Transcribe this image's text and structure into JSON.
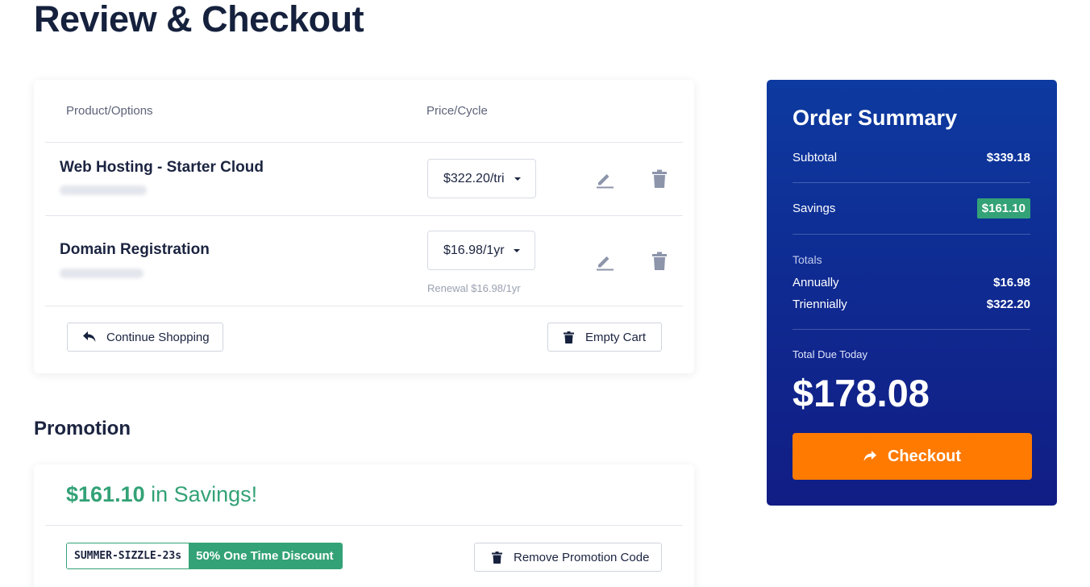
{
  "page": {
    "title": "Review & Checkout"
  },
  "cart": {
    "columns": {
      "product": "Product/Options",
      "price": "Price/Cycle"
    },
    "items": [
      {
        "name": "Web Hosting - Starter Cloud",
        "price_cycle": "$322.20/tri",
        "renewal": ""
      },
      {
        "name": "Domain Registration",
        "price_cycle": "$16.98/1yr",
        "renewal": "Renewal $16.98/1yr"
      }
    ],
    "continue_label": "Continue Shopping",
    "empty_label": "Empty Cart"
  },
  "promotion": {
    "heading": "Promotion",
    "savings_amount": "$161.10",
    "savings_text": " in Savings!",
    "code": "SUMMER-SIZZLE-23s",
    "discount": "50% One Time Discount",
    "remove_label": "Remove Promotion Code"
  },
  "summary": {
    "title": "Order Summary",
    "subtotal_label": "Subtotal",
    "subtotal_value": "$339.18",
    "savings_label": "Savings",
    "savings_value": "$161.10",
    "totals_label": "Totals",
    "annually_label": "Annually",
    "annually_value": "$16.98",
    "triennially_label": "Triennially",
    "triennially_value": "$322.20",
    "due_label": "Total Due Today",
    "due_value": "$178.08",
    "checkout_label": "Checkout"
  },
  "colors": {
    "accent_orange": "#ff7a00",
    "savings_green": "#33a276",
    "summary_blue": "#0f2a91",
    "heading_navy": "#15213d"
  }
}
